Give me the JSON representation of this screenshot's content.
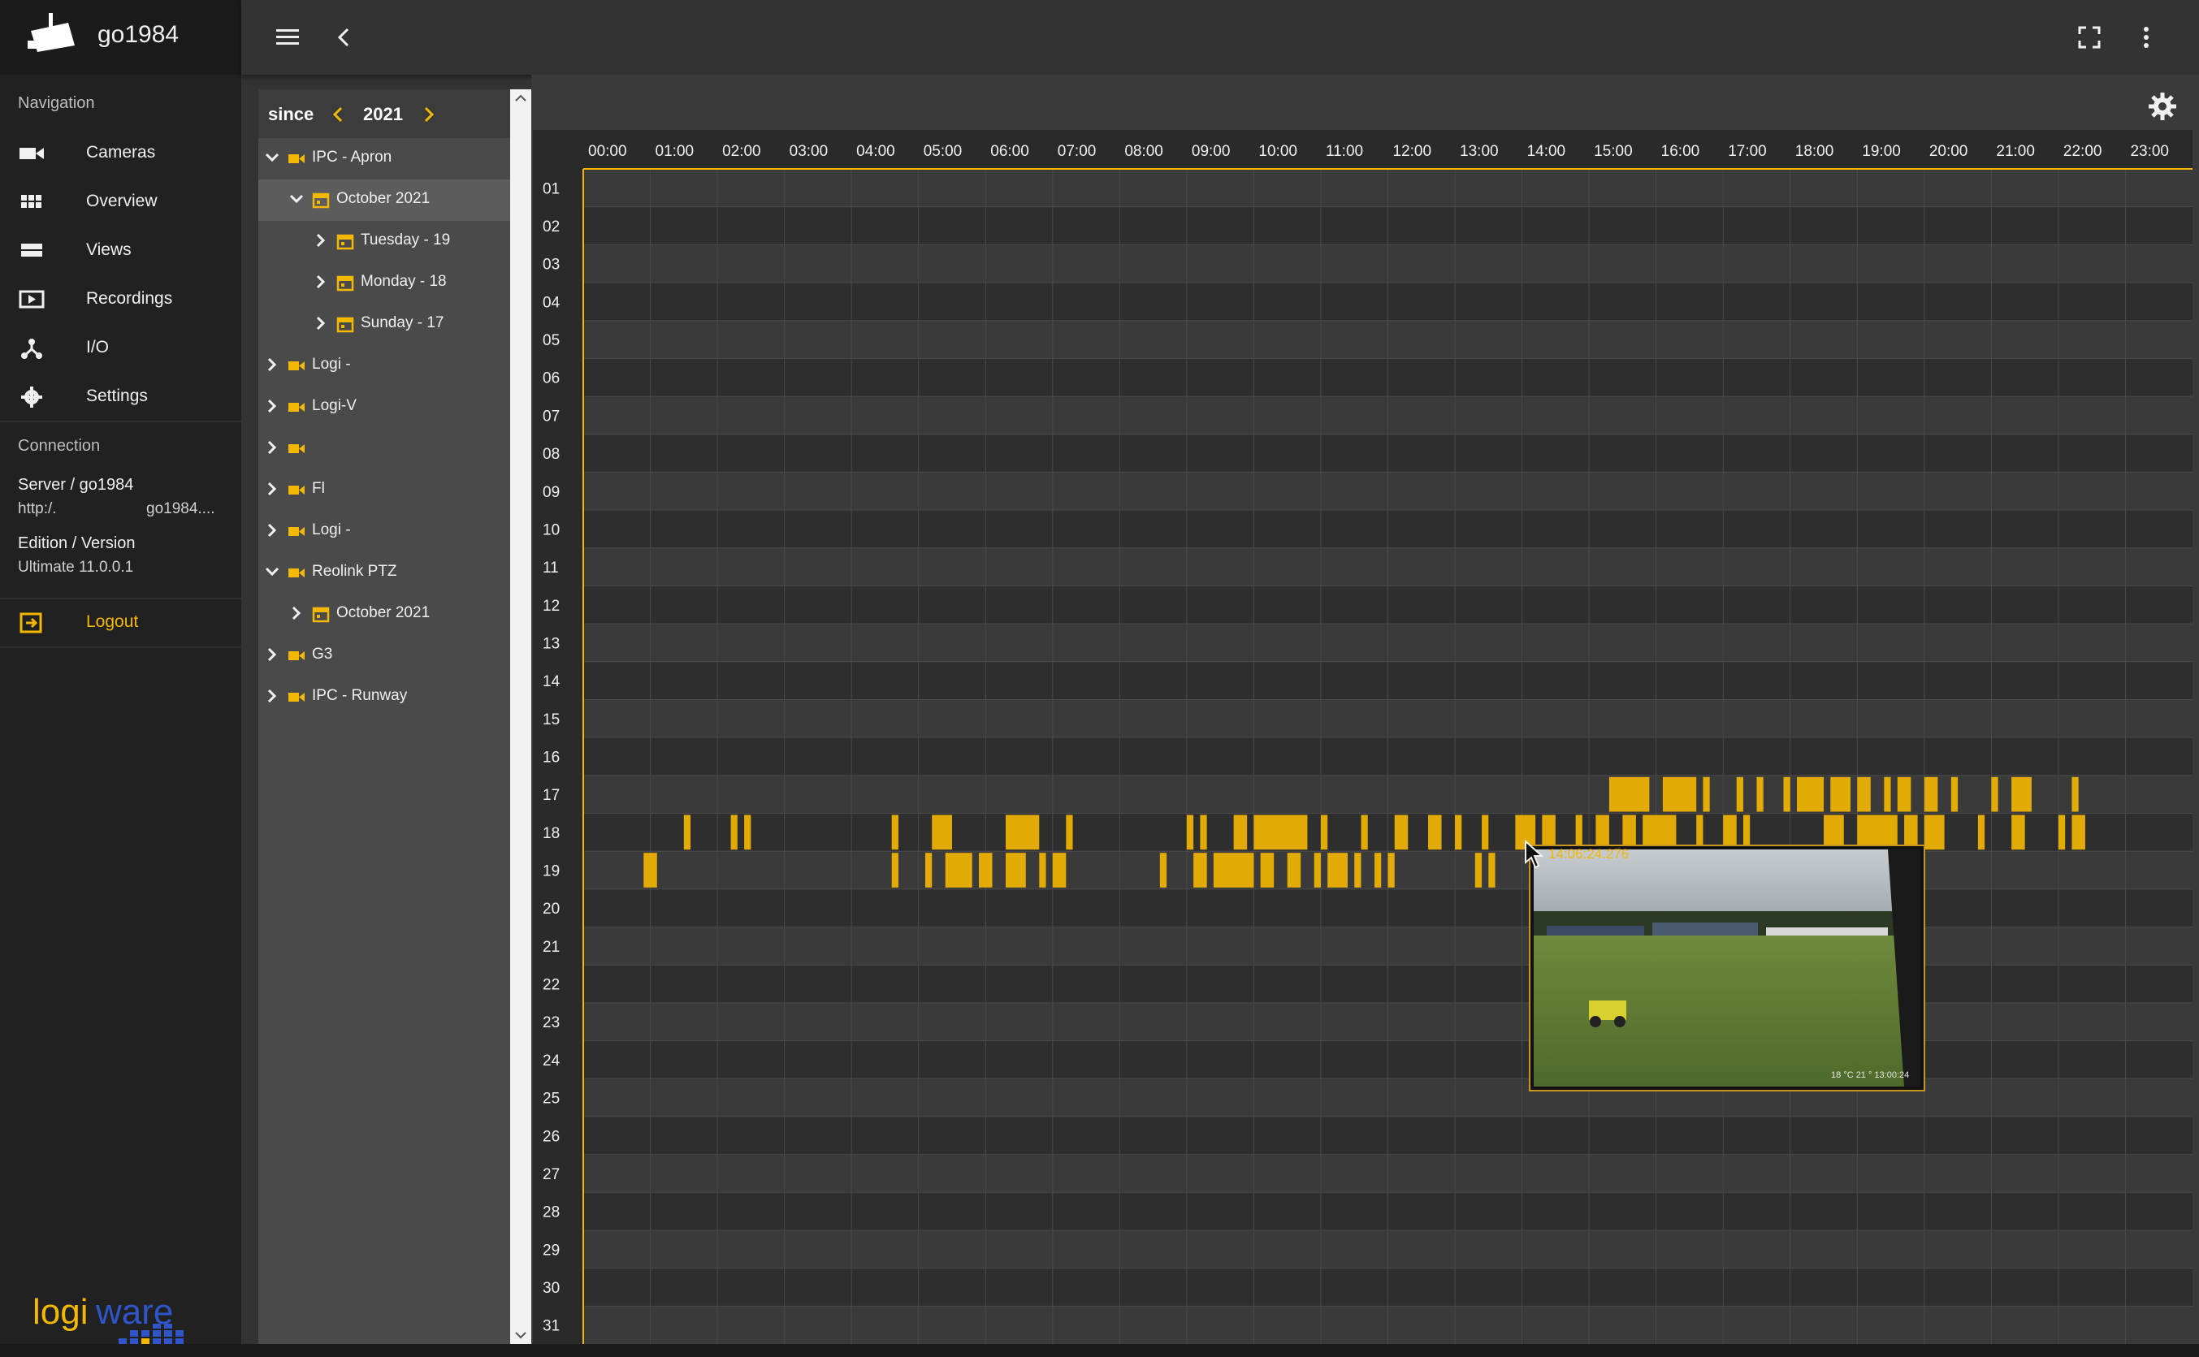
{
  "app": {
    "title": "go1984"
  },
  "nav": {
    "section_navigation": "Navigation",
    "items": [
      {
        "label": "Cameras",
        "icon": "video-camera-icon"
      },
      {
        "label": "Overview",
        "icon": "grid-icon"
      },
      {
        "label": "Views",
        "icon": "views-icon"
      },
      {
        "label": "Recordings",
        "icon": "recordings-icon"
      },
      {
        "label": "I/O",
        "icon": "io-icon"
      },
      {
        "label": "Settings",
        "icon": "gear-icon"
      }
    ],
    "section_connection": "Connection",
    "server_label": "Server / go1984",
    "server_url_left": "http:/.",
    "server_url_right": "go1984....",
    "edition_label": "Edition / Version",
    "edition_value": "Ultimate 11.0.0.1",
    "logout_label": "Logout",
    "brand": "logiware"
  },
  "tree": {
    "since_label": "since",
    "year": "2021",
    "rows": [
      {
        "label": "IPC - Apron",
        "level": 0,
        "type": "camera",
        "expanded": true
      },
      {
        "label": "October 2021",
        "level": 1,
        "type": "calendar",
        "expanded": true,
        "selected": true
      },
      {
        "label": "Tuesday - 19",
        "level": 2,
        "type": "calendar",
        "expanded": false
      },
      {
        "label": "Monday - 18",
        "level": 2,
        "type": "calendar",
        "expanded": false
      },
      {
        "label": "Sunday - 17",
        "level": 2,
        "type": "calendar",
        "expanded": false
      },
      {
        "label": "Logi - ",
        "level": 0,
        "type": "camera",
        "expanded": false
      },
      {
        "label": "Logi-V",
        "level": 0,
        "type": "camera",
        "expanded": false
      },
      {
        "label": "",
        "level": 0,
        "type": "camera",
        "expanded": false
      },
      {
        "label": "Fl",
        "level": 0,
        "type": "camera",
        "expanded": false
      },
      {
        "label": "Logi - ",
        "level": 0,
        "type": "camera",
        "expanded": false
      },
      {
        "label": "Reolink PTZ",
        "level": 0,
        "type": "camera",
        "expanded": true
      },
      {
        "label": "October 2021",
        "level": 1,
        "type": "calendar",
        "expanded": false
      },
      {
        "label": "G3",
        "level": 0,
        "type": "camera",
        "expanded": false
      },
      {
        "label": "IPC - Runway",
        "level": 0,
        "type": "camera",
        "expanded": false
      }
    ]
  },
  "timeline": {
    "hours": [
      "00:00",
      "01:00",
      "02:00",
      "03:00",
      "04:00",
      "05:00",
      "06:00",
      "07:00",
      "08:00",
      "09:00",
      "10:00",
      "11:00",
      "12:00",
      "13:00",
      "14:00",
      "15:00",
      "16:00",
      "17:00",
      "18:00",
      "19:00",
      "20:00",
      "21:00",
      "22:00",
      "23:00"
    ],
    "days": [
      "01",
      "02",
      "03",
      "04",
      "05",
      "06",
      "07",
      "08",
      "09",
      "10",
      "11",
      "12",
      "13",
      "14",
      "15",
      "16",
      "17",
      "18",
      "19",
      "20",
      "21",
      "22",
      "23",
      "24",
      "25",
      "26",
      "27",
      "28",
      "29",
      "30",
      "31"
    ],
    "accent_color": "#f5b800",
    "recordings": {
      "17": [
        [
          15.3,
          15.9
        ],
        [
          16.1,
          16.6
        ],
        [
          16.7,
          16.8
        ],
        [
          17.2,
          17.3
        ],
        [
          17.5,
          17.6
        ],
        [
          17.9,
          18.0
        ],
        [
          18.1,
          18.5
        ],
        [
          18.6,
          18.9
        ],
        [
          19.0,
          19.2
        ],
        [
          19.4,
          19.5
        ],
        [
          19.6,
          19.8
        ],
        [
          20.0,
          20.2
        ],
        [
          20.4,
          20.5
        ],
        [
          21.0,
          21.1
        ],
        [
          21.3,
          21.6
        ],
        [
          22.2,
          22.3
        ]
      ],
      "18": [
        [
          1.5,
          1.6
        ],
        [
          2.2,
          2.3
        ],
        [
          2.4,
          2.5
        ],
        [
          4.6,
          4.7
        ],
        [
          5.2,
          5.5
        ],
        [
          6.3,
          6.8
        ],
        [
          7.2,
          7.3
        ],
        [
          9.0,
          9.1
        ],
        [
          9.2,
          9.3
        ],
        [
          9.7,
          9.9
        ],
        [
          10.0,
          10.8
        ],
        [
          11.0,
          11.1
        ],
        [
          11.6,
          11.7
        ],
        [
          12.1,
          12.3
        ],
        [
          12.6,
          12.8
        ],
        [
          13.0,
          13.1
        ],
        [
          13.4,
          13.5
        ],
        [
          13.9,
          14.2
        ],
        [
          14.3,
          14.5
        ],
        [
          14.8,
          14.9
        ],
        [
          15.1,
          15.3
        ],
        [
          15.5,
          15.7
        ],
        [
          15.8,
          16.3
        ],
        [
          16.6,
          16.7
        ],
        [
          17.0,
          17.2
        ],
        [
          17.3,
          17.4
        ],
        [
          18.5,
          18.8
        ],
        [
          19.0,
          19.6
        ],
        [
          19.7,
          19.9
        ],
        [
          20.0,
          20.3
        ],
        [
          20.8,
          20.9
        ],
        [
          21.3,
          21.5
        ],
        [
          22.0,
          22.1
        ],
        [
          22.2,
          22.4
        ]
      ],
      "19": [
        [
          0.9,
          1.1
        ],
        [
          4.6,
          4.7
        ],
        [
          5.1,
          5.2
        ],
        [
          5.4,
          5.8
        ],
        [
          5.9,
          6.1
        ],
        [
          6.3,
          6.6
        ],
        [
          6.8,
          6.9
        ],
        [
          7.0,
          7.2
        ],
        [
          8.6,
          8.7
        ],
        [
          9.1,
          9.3
        ],
        [
          9.4,
          10.0
        ],
        [
          10.1,
          10.3
        ],
        [
          10.5,
          10.7
        ],
        [
          10.9,
          11.0
        ],
        [
          11.1,
          11.4
        ],
        [
          11.5,
          11.6
        ],
        [
          11.8,
          11.9
        ],
        [
          12.0,
          12.1
        ],
        [
          13.3,
          13.4
        ],
        [
          13.5,
          13.6
        ]
      ]
    },
    "preview": {
      "time": "14:06:24.276",
      "overlay_text": "18 °C 21 °   13:00:24"
    }
  }
}
